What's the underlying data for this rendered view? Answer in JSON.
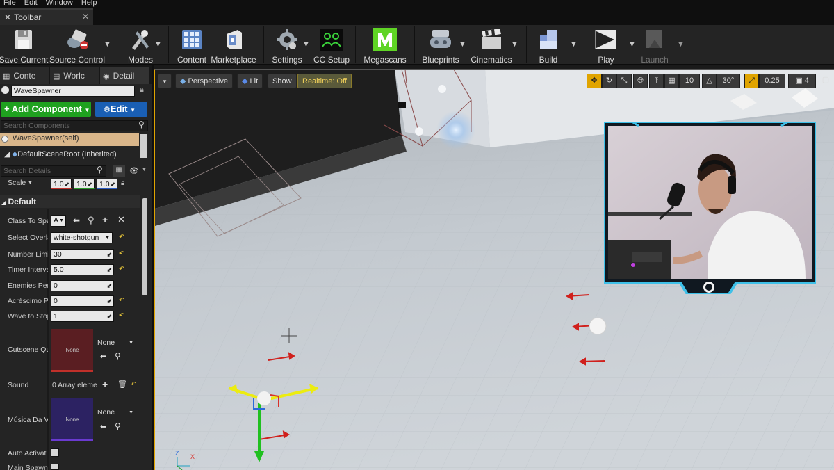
{
  "menu": [
    "File",
    "Edit",
    "Window",
    "Help"
  ],
  "toolbar_tab": {
    "title": "Toolbar"
  },
  "toolbar": {
    "save_current": "Save Current",
    "source_control": "Source Control",
    "modes": "Modes",
    "content": "Content",
    "marketplace": "Marketplace",
    "settings": "Settings",
    "cc_setup": "CC Setup",
    "megascans": "Megascans",
    "blueprints": "Blueprints",
    "cinematics": "Cinematics",
    "build": "Build",
    "play": "Play",
    "launch": "Launch"
  },
  "panel_tabs": [
    "Conte",
    "Worlc",
    "Detail"
  ],
  "details": {
    "actor_name": "WaveSpawner",
    "add_component": "Add Component",
    "edit": "Edit",
    "search_components_placeholder": "Search Components",
    "self_item": "WaveSpawner(self)",
    "root_item": "DefaultSceneRoot (Inherited)",
    "search_details_placeholder": "Search Details",
    "scale_label": "Scale",
    "scale_values": [
      "1.0",
      "1.0",
      "1.0"
    ],
    "section_default": "Default",
    "class_to_spawn_label": "Class To Spa",
    "class_to_spawn_value": "A",
    "select_overlay_label": "Select Overla",
    "select_overlay_value": "white-shotgun",
    "number_limit_label": "Number Limi",
    "number_limit_value": "30",
    "timer_interval_label": "Timer Interva",
    "timer_interval_value": "5.0",
    "enemies_per_label": "Enemies Per",
    "enemies_per_value": "0",
    "acrescimo_label": "Acréscimo P",
    "acrescimo_value": "0",
    "wave_to_stop_label": "Wave to Stop",
    "wave_to_stop_value": "1",
    "cutscene_label": "Cutscene Qu",
    "cutscene_thumb": "None",
    "cutscene_select": "None",
    "sound_label": "Sound",
    "sound_value": "0 Array eleme",
    "musica_label": "Música Da V",
    "musica_thumb": "None",
    "musica_select": "None",
    "auto_activate_label": "Auto Activat",
    "main_spawner_label": "Main Spawne"
  },
  "viewport": {
    "perspective": "Perspective",
    "lit": "Lit",
    "show": "Show",
    "realtime": "Realtime: Off",
    "grid_snap": "10",
    "rot_snap": "30°",
    "scale_snap": "0.25",
    "camera_speed": "4",
    "axis_z": "Z",
    "axis_x": "X"
  },
  "colors": {
    "accent_green": "#1fa11f",
    "accent_blue": "#1a5fb4",
    "highlight_yellow": "#e0a400",
    "megascans_green": "#5fd425",
    "webcam_frame": "#3ec0e8"
  }
}
